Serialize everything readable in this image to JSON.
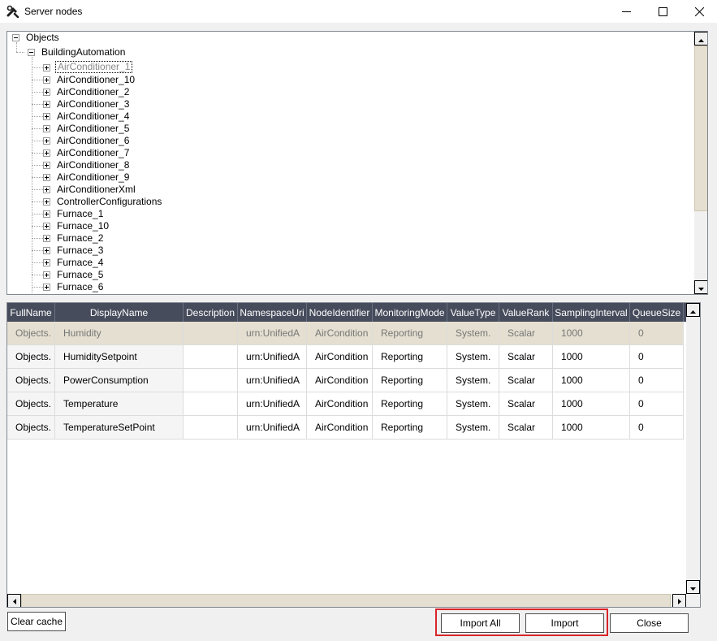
{
  "window": {
    "title": "Server nodes",
    "icons": {
      "app": "tools-icon",
      "minimize": "minimize-icon",
      "maximize": "maximize-icon",
      "close": "close-icon"
    }
  },
  "tree": {
    "root": "Objects",
    "child": "BuildingAutomation",
    "items": [
      "AirConditioner_1",
      "AirConditioner_10",
      "AirConditioner_2",
      "AirConditioner_3",
      "AirConditioner_4",
      "AirConditioner_5",
      "AirConditioner_6",
      "AirConditioner_7",
      "AirConditioner_8",
      "AirConditioner_9",
      "AirConditionerXml",
      "ControllerConfigurations",
      "Furnace_1",
      "Furnace_10",
      "Furnace_2",
      "Furnace_3",
      "Furnace_4",
      "Furnace_5",
      "Furnace_6"
    ]
  },
  "grid": {
    "columns": [
      "FullName",
      "DisplayName",
      "Description",
      "NamespaceUri",
      "NodeIdentifier",
      "MonitoringMode",
      "ValueType",
      "ValueRank",
      "SamplingInterval",
      "QueueSize"
    ],
    "rows": [
      [
        "Objects.",
        "Humidity",
        "",
        "urn:UnifiedA",
        "AirCondition",
        "Reporting",
        "System.",
        "Scalar",
        "1000",
        "0"
      ],
      [
        "Objects.",
        "HumiditySetpoint",
        "",
        "urn:UnifiedA",
        "AirCondition",
        "Reporting",
        "System.",
        "Scalar",
        "1000",
        "0"
      ],
      [
        "Objects.",
        "PowerConsumption",
        "",
        "urn:UnifiedA",
        "AirCondition",
        "Reporting",
        "System.",
        "Scalar",
        "1000",
        "0"
      ],
      [
        "Objects.",
        "Temperature",
        "",
        "urn:UnifiedA",
        "AirCondition",
        "Reporting",
        "System.",
        "Scalar",
        "1000",
        "0"
      ],
      [
        "Objects.",
        "TemperatureSetPoint",
        "",
        "urn:UnifiedA",
        "AirCondition",
        "Reporting",
        "System.",
        "Scalar",
        "1000",
        "0"
      ]
    ]
  },
  "buttons": {
    "clear_cache": "Clear cache",
    "import_all": "Import All",
    "import": "Import",
    "close": "Close"
  },
  "colors": {
    "header_bg": "#474c5c",
    "selected_row": "#e4dfd0",
    "highlight_border": "#d8262a"
  }
}
